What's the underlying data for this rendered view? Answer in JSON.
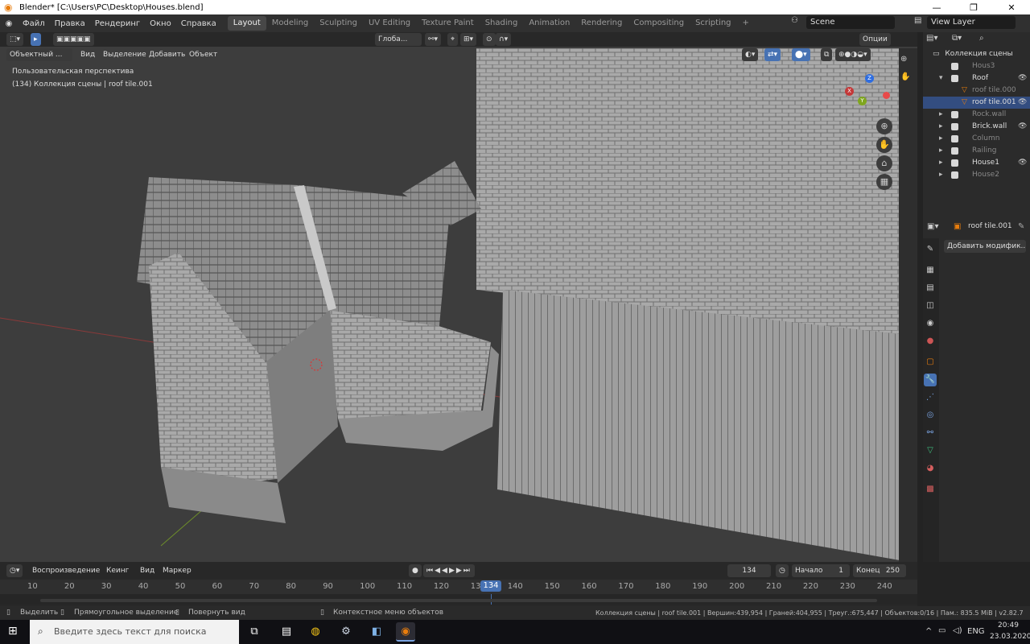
{
  "window": {
    "title": "Blender* [C:\\Users\\PC\\Desktop\\Houses.blend]",
    "minimize": "—",
    "maximize": "❐",
    "close": "✕"
  },
  "menu": [
    "Файл",
    "Правка",
    "Рендеринг",
    "Окно",
    "Справка"
  ],
  "workspaces": [
    "Layout",
    "Modeling",
    "Sculpting",
    "UV Editing",
    "Texture Paint",
    "Shading",
    "Animation",
    "Rendering",
    "Compositing",
    "Scripting"
  ],
  "workspace_add": "+",
  "scene": {
    "name": "Scene",
    "view_layer": "View Layer"
  },
  "header": {
    "transform_orientation": "Глоба...",
    "options": "Опции"
  },
  "viewport_header": {
    "mode": "Объектный ...",
    "view": "Вид",
    "select": "Выделение",
    "add": "Добавить",
    "object": "Объект"
  },
  "viewport": {
    "perspective": "Пользовательская перспектива",
    "collection_info": "(134) Коллекция сцены | roof tile.001",
    "axis_x": "X",
    "axis_y": "Y",
    "axis_z": "Z"
  },
  "outliner": {
    "root": "Коллекция сцены",
    "items": [
      {
        "name": "Hous3",
        "dim": true
      },
      {
        "name": "Roof",
        "dim": false
      },
      {
        "name": "roof tile.000",
        "dim": true
      },
      {
        "name": "roof tile.001",
        "dim": false
      },
      {
        "name": "Rock.wall",
        "dim": true
      },
      {
        "name": "Brick.wall",
        "dim": false
      },
      {
        "name": "Column",
        "dim": true
      },
      {
        "name": "Railing",
        "dim": true
      },
      {
        "name": "House1",
        "dim": false
      },
      {
        "name": "House2",
        "dim": true
      }
    ]
  },
  "properties": {
    "object_name": "roof tile.001",
    "add_modifier": "Добавить модифик..."
  },
  "timeline": {
    "playback": "Воспроизведение",
    "keying": "Кеинг",
    "view": "Вид",
    "marker": "Маркер",
    "current_frame": "134",
    "start_label": "Начало",
    "start_value": "1",
    "end_label": "Конец",
    "end_value": "250",
    "ruler": [
      "10",
      "20",
      "30",
      "40",
      "50",
      "60",
      "70",
      "80",
      "90",
      "100",
      "110",
      "120",
      "130",
      "140",
      "150",
      "160",
      "170",
      "180",
      "190",
      "200",
      "210",
      "220",
      "230",
      "240"
    ]
  },
  "status": {
    "select": "Выделить",
    "box_select": "Прямоугольное выделение",
    "rotate": "Повернуть вид",
    "context": "Контекстное меню объектов",
    "stats": "Коллекция сцены | roof tile.001 | Вершин:439,954 | Граней:404,955 | Треуг.:675,447 | Объектов:0/16 | Пам.: 835.5 MiB | v2.82.7"
  },
  "taskbar": {
    "search_placeholder": "Введите здесь текст для поиска",
    "language": "ENG",
    "time": "20:49",
    "date": "23.03.2020"
  },
  "colors": {
    "accent": "#4772b3",
    "active_object": "#e87d0d",
    "header": "#303030"
  }
}
